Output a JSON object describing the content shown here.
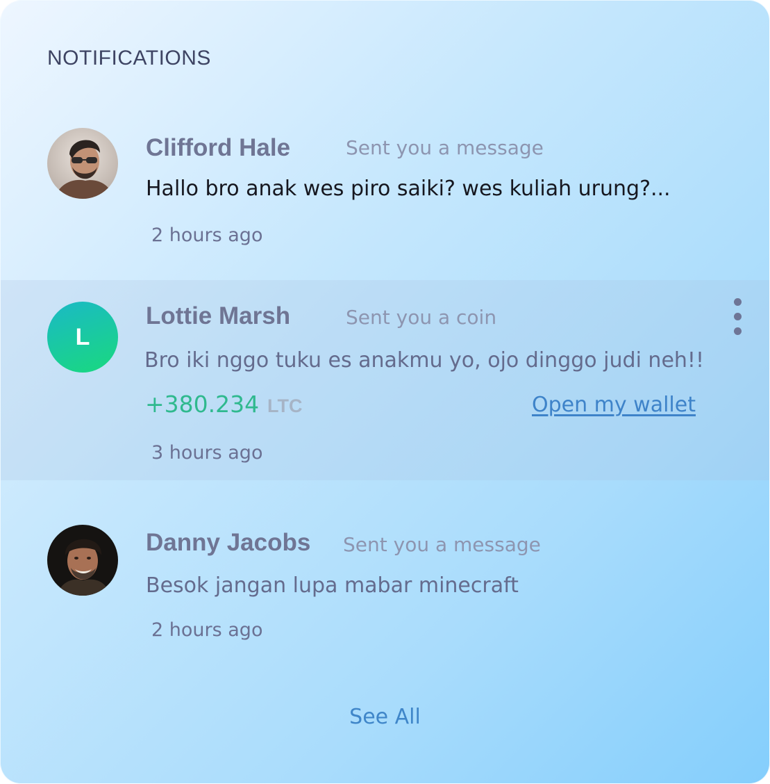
{
  "panel": {
    "title": "NOTIFICATIONS",
    "see_all_label": "See All"
  },
  "notifications": [
    {
      "avatar": "photo-avatar-man-with-sunglasses",
      "name": "Clifford Hale",
      "action": "Sent you a message",
      "message": "Hallo bro anak wes piro saiki? wes kuliah urung?...",
      "time": "2 hours ago"
    },
    {
      "avatar_letter": "L",
      "avatar_colors": [
        "#1bb9c6",
        "#19d97e"
      ],
      "name": "Lottie Marsh",
      "action": "Sent you a coin",
      "message": "Bro iki nggo tuku es anakmu yo, ojo dinggo judi neh!!",
      "amount": "+380.234",
      "currency": "LTC",
      "link_label": "Open my wallet",
      "time": "3 hours ago",
      "highlighted": true,
      "menu_icon": "more-vertical-icon"
    },
    {
      "avatar": "photo-avatar-smiling-man",
      "name": "Danny Jacobs",
      "action": "Sent you a message",
      "message": "Besok jangan lupa mabar minecraft",
      "time": "2 hours ago"
    }
  ],
  "colors": {
    "title": "#3e4463",
    "name": "#6f7594",
    "amount": "#2fb98e",
    "link": "#3e83c9"
  }
}
